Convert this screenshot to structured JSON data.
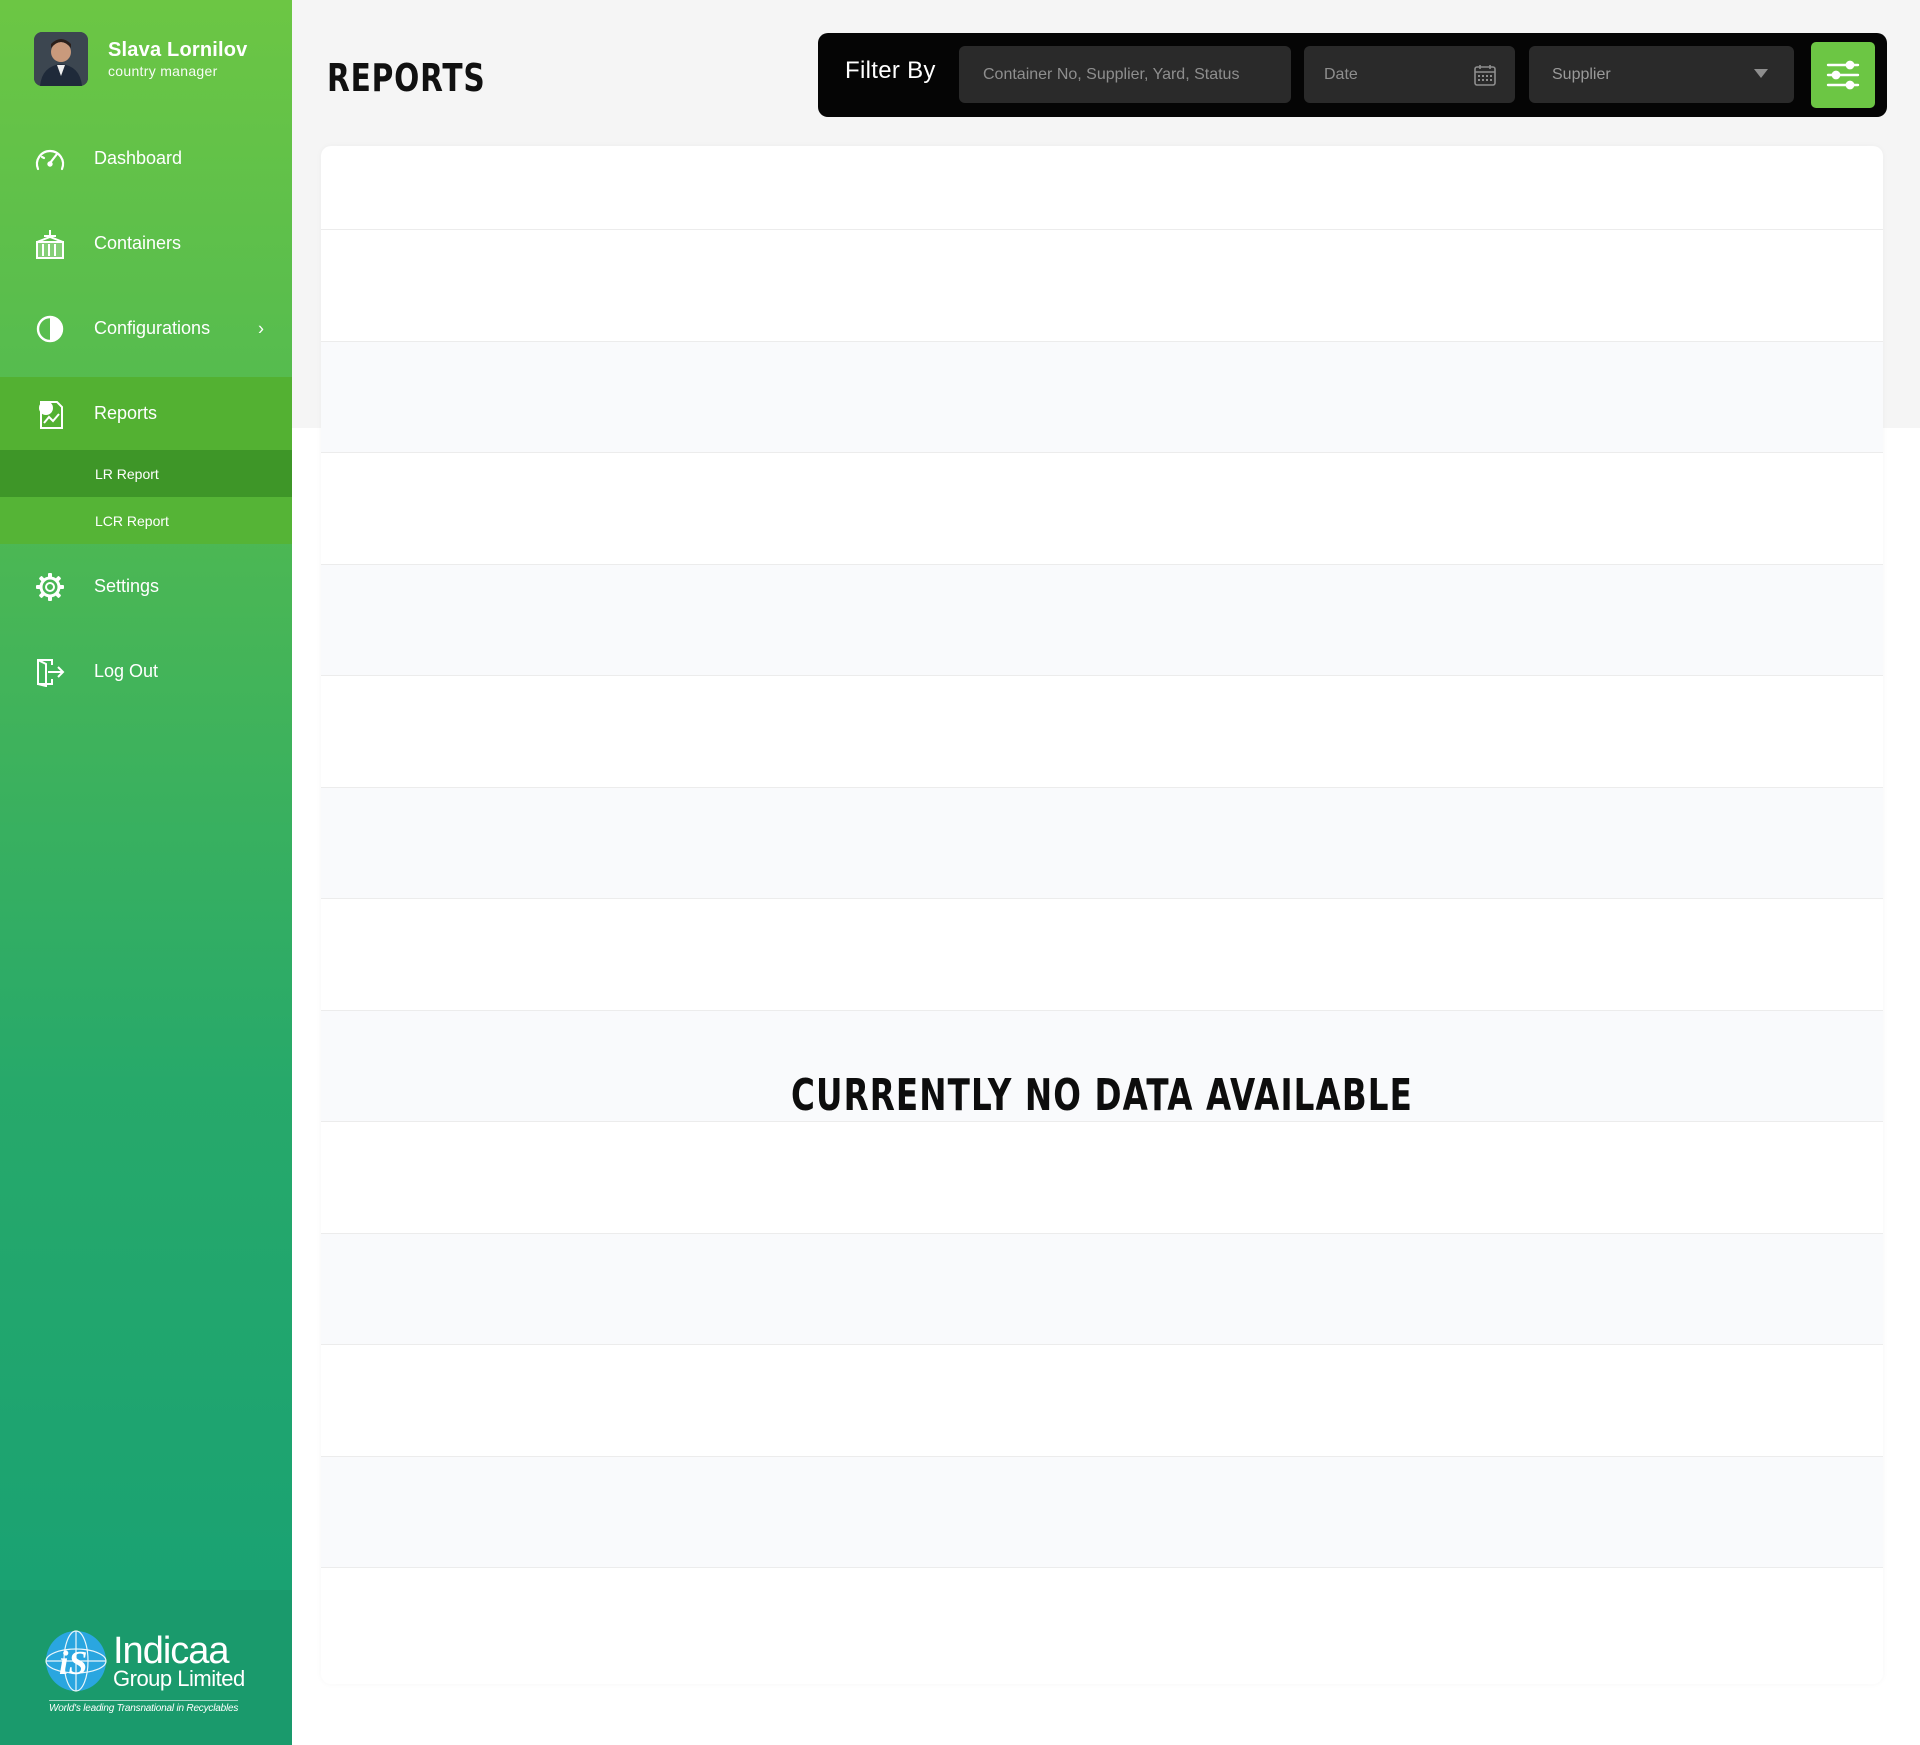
{
  "user": {
    "name": "Slava Lornilov",
    "role": "country manager"
  },
  "nav": {
    "items": [
      {
        "label": "Dashboard",
        "icon": "speedometer-icon"
      },
      {
        "label": "Containers",
        "icon": "container-icon"
      },
      {
        "label": "Configurations",
        "icon": "half-circle-icon"
      },
      {
        "label": "Reports",
        "icon": "report-icon"
      },
      {
        "label": "Settings",
        "icon": "gear-icon"
      },
      {
        "label": "Log Out",
        "icon": "logout-icon"
      }
    ],
    "reports_submenu": [
      {
        "label": "LR Report"
      },
      {
        "label": "LCR Report"
      }
    ]
  },
  "brand": {
    "name": "Indicaa",
    "sub": "Group Limited",
    "tagline": "World's leading Transnational in Recyclables"
  },
  "page": {
    "title": "REPORTS"
  },
  "filter": {
    "label": "Filter By",
    "search_placeholder": "Container No, Supplier, Yard, Status",
    "date_placeholder": "Date",
    "supplier_value": "Supplier"
  },
  "table": {
    "empty_message": "CURRENTLY NO DATA AVAILABLE"
  },
  "colors": {
    "accent": "#6cc644",
    "sidebar_bottom": "#16a075",
    "filter_bar": "#050505"
  }
}
